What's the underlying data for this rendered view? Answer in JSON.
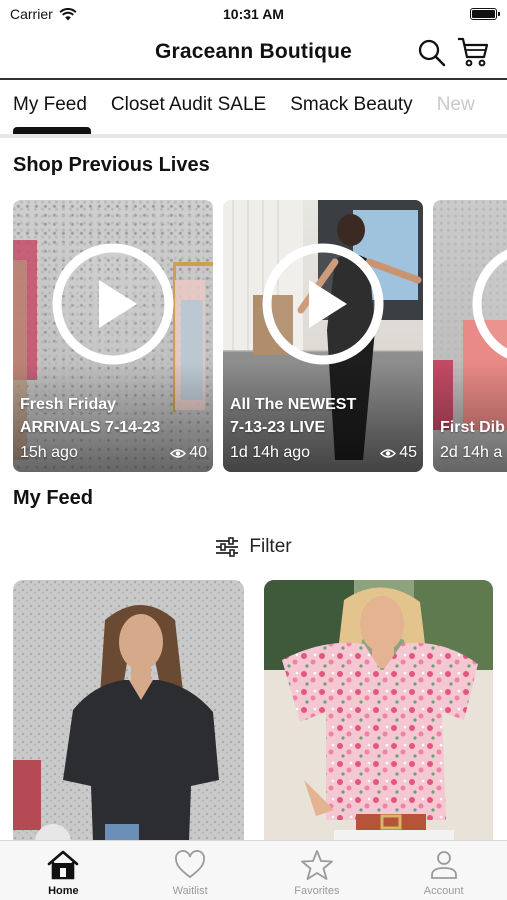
{
  "status_bar": {
    "carrier": "Carrier",
    "time": "10:31 AM"
  },
  "header": {
    "title": "Graceann Boutique",
    "search_icon": "search-icon",
    "cart_icon": "cart-icon"
  },
  "tabs": [
    {
      "label": "My Feed",
      "selected": true
    },
    {
      "label": "Closet Audit SALE",
      "selected": false
    },
    {
      "label": "Smack Beauty",
      "selected": false
    },
    {
      "label": "New",
      "selected": false
    }
  ],
  "previous_lives": {
    "title": "Shop Previous Lives",
    "items": [
      {
        "line1": "Fresh Friday",
        "line2": "ARRIVALS 7-14-23",
        "ago": "15h ago",
        "views": "40"
      },
      {
        "line1": "All The NEWEST",
        "line2": "7-13-23 LIVE",
        "ago": "1d 14h ago",
        "views": "45"
      },
      {
        "line1": "",
        "line2": "First Dib",
        "ago": "2d 14h a",
        "views": ""
      }
    ]
  },
  "feed": {
    "title": "My Feed",
    "filter_label": "Filter"
  },
  "bottom_nav": [
    {
      "label": "Home",
      "icon": "home-icon",
      "active": true
    },
    {
      "label": "Waitlist",
      "icon": "heart-icon",
      "active": false
    },
    {
      "label": "Favorites",
      "icon": "star-icon",
      "active": false
    },
    {
      "label": "Account",
      "icon": "person-icon",
      "active": false
    }
  ],
  "colors": {
    "text": "#111111",
    "inactive": "#9a9a9a",
    "divider": "#e6e6e6",
    "nav_bg": "#f7f7f7"
  }
}
